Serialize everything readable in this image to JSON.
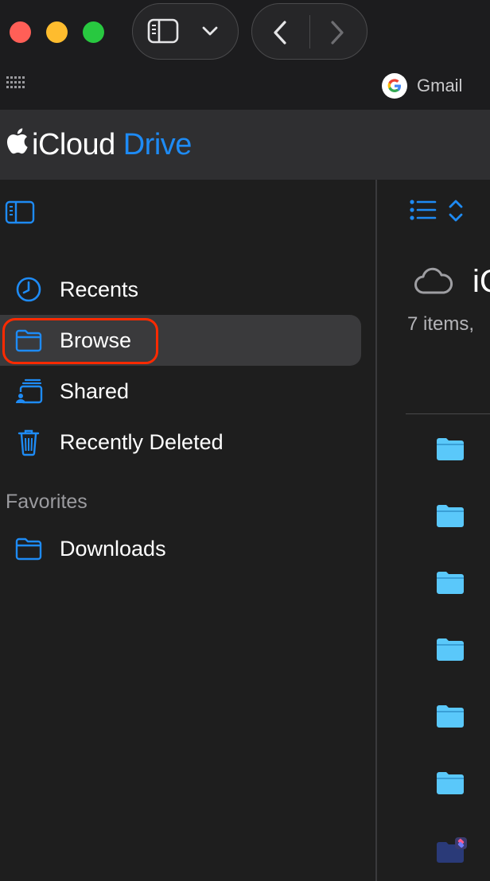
{
  "browser": {
    "bookmark_label": "Gmail",
    "icons": {
      "sidebar_toggle": "sidebar-icon",
      "dropdown": "chevron-down-icon",
      "back": "chevron-left-icon",
      "forward": "chevron-right-icon",
      "apps": "grid-icon",
      "bookmark": "google-icon"
    }
  },
  "header": {
    "brand_word": "iCloud",
    "brand_product": "Drive",
    "brand_product_color": "#1e8bf5"
  },
  "sidebar": {
    "items": [
      {
        "label": "Recents",
        "icon": "clock-icon",
        "selected": false
      },
      {
        "label": "Browse",
        "icon": "folder-icon",
        "selected": true
      },
      {
        "label": "Shared",
        "icon": "shared-folder-icon",
        "selected": false
      },
      {
        "label": "Recently Deleted",
        "icon": "trash-icon",
        "selected": false
      }
    ],
    "favorites_heading": "Favorites",
    "favorites": [
      {
        "label": "Downloads",
        "icon": "folder-icon"
      }
    ]
  },
  "main": {
    "title": "iC",
    "subtitle": "7 items,",
    "toolbar_icons": [
      "list-view-icon",
      "sort-icon"
    ],
    "header_icon": "cloud-icon",
    "rows": [
      {
        "icon": "folder-icon"
      },
      {
        "icon": "folder-icon"
      },
      {
        "icon": "folder-icon"
      },
      {
        "icon": "folder-icon"
      },
      {
        "icon": "folder-icon"
      },
      {
        "icon": "folder-icon"
      },
      {
        "icon": "shortcuts-folder-icon"
      }
    ]
  },
  "colors": {
    "accent": "#1e8bf5",
    "folder": "#5ac8fa",
    "selection_ring": "#ff2a00"
  }
}
